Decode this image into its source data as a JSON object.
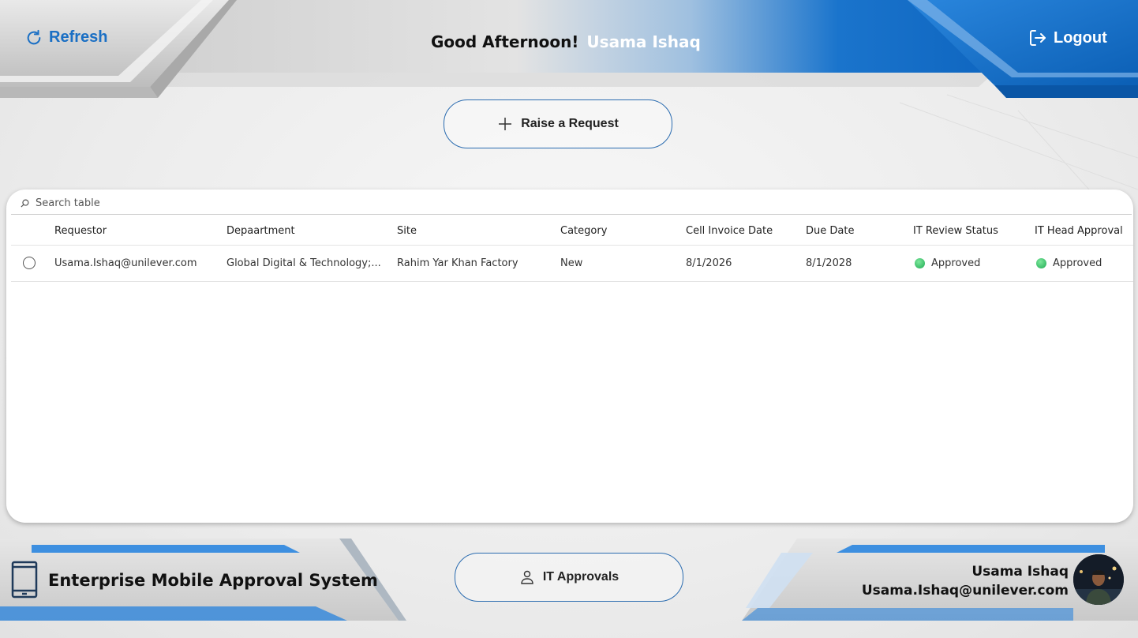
{
  "header": {
    "refresh_label": "Refresh",
    "greeting": "Good Afternoon!",
    "user_name": "Usama Ishaq",
    "logout_label": "Logout"
  },
  "actions": {
    "raise_request_label": "Raise a Request",
    "it_approvals_label": "IT Approvals"
  },
  "table": {
    "search_placeholder": "Search table",
    "columns": [
      "Requestor",
      "Depaartment",
      "Site",
      "Category",
      "Cell Invoice Date",
      "Due Date",
      "IT Review Status",
      "IT Head Approval"
    ],
    "rows": [
      {
        "requestor": "Usama.Ishaq@unilever.com",
        "department": "Global Digital & Technology;...",
        "site": "Rahim Yar Khan Factory",
        "category": "New",
        "cell_invoice_date": "8/1/2026",
        "due_date": "8/1/2028",
        "it_review_status": "Approved",
        "it_head_approval": "Approved"
      }
    ]
  },
  "footer": {
    "system_title": "Enterprise Mobile Approval System",
    "user_name": "Usama Ishaq",
    "user_email": "Usama.Ishaq@unilever.com"
  },
  "colors": {
    "accent_blue": "#1a6fc4",
    "status_green": "#1eaa53"
  },
  "icons": {
    "refresh": "refresh-icon",
    "logout": "logout-icon",
    "raise": "plus-icon",
    "it_approvals": "person-icon",
    "system": "tablet-icon",
    "search": "search-icon"
  }
}
